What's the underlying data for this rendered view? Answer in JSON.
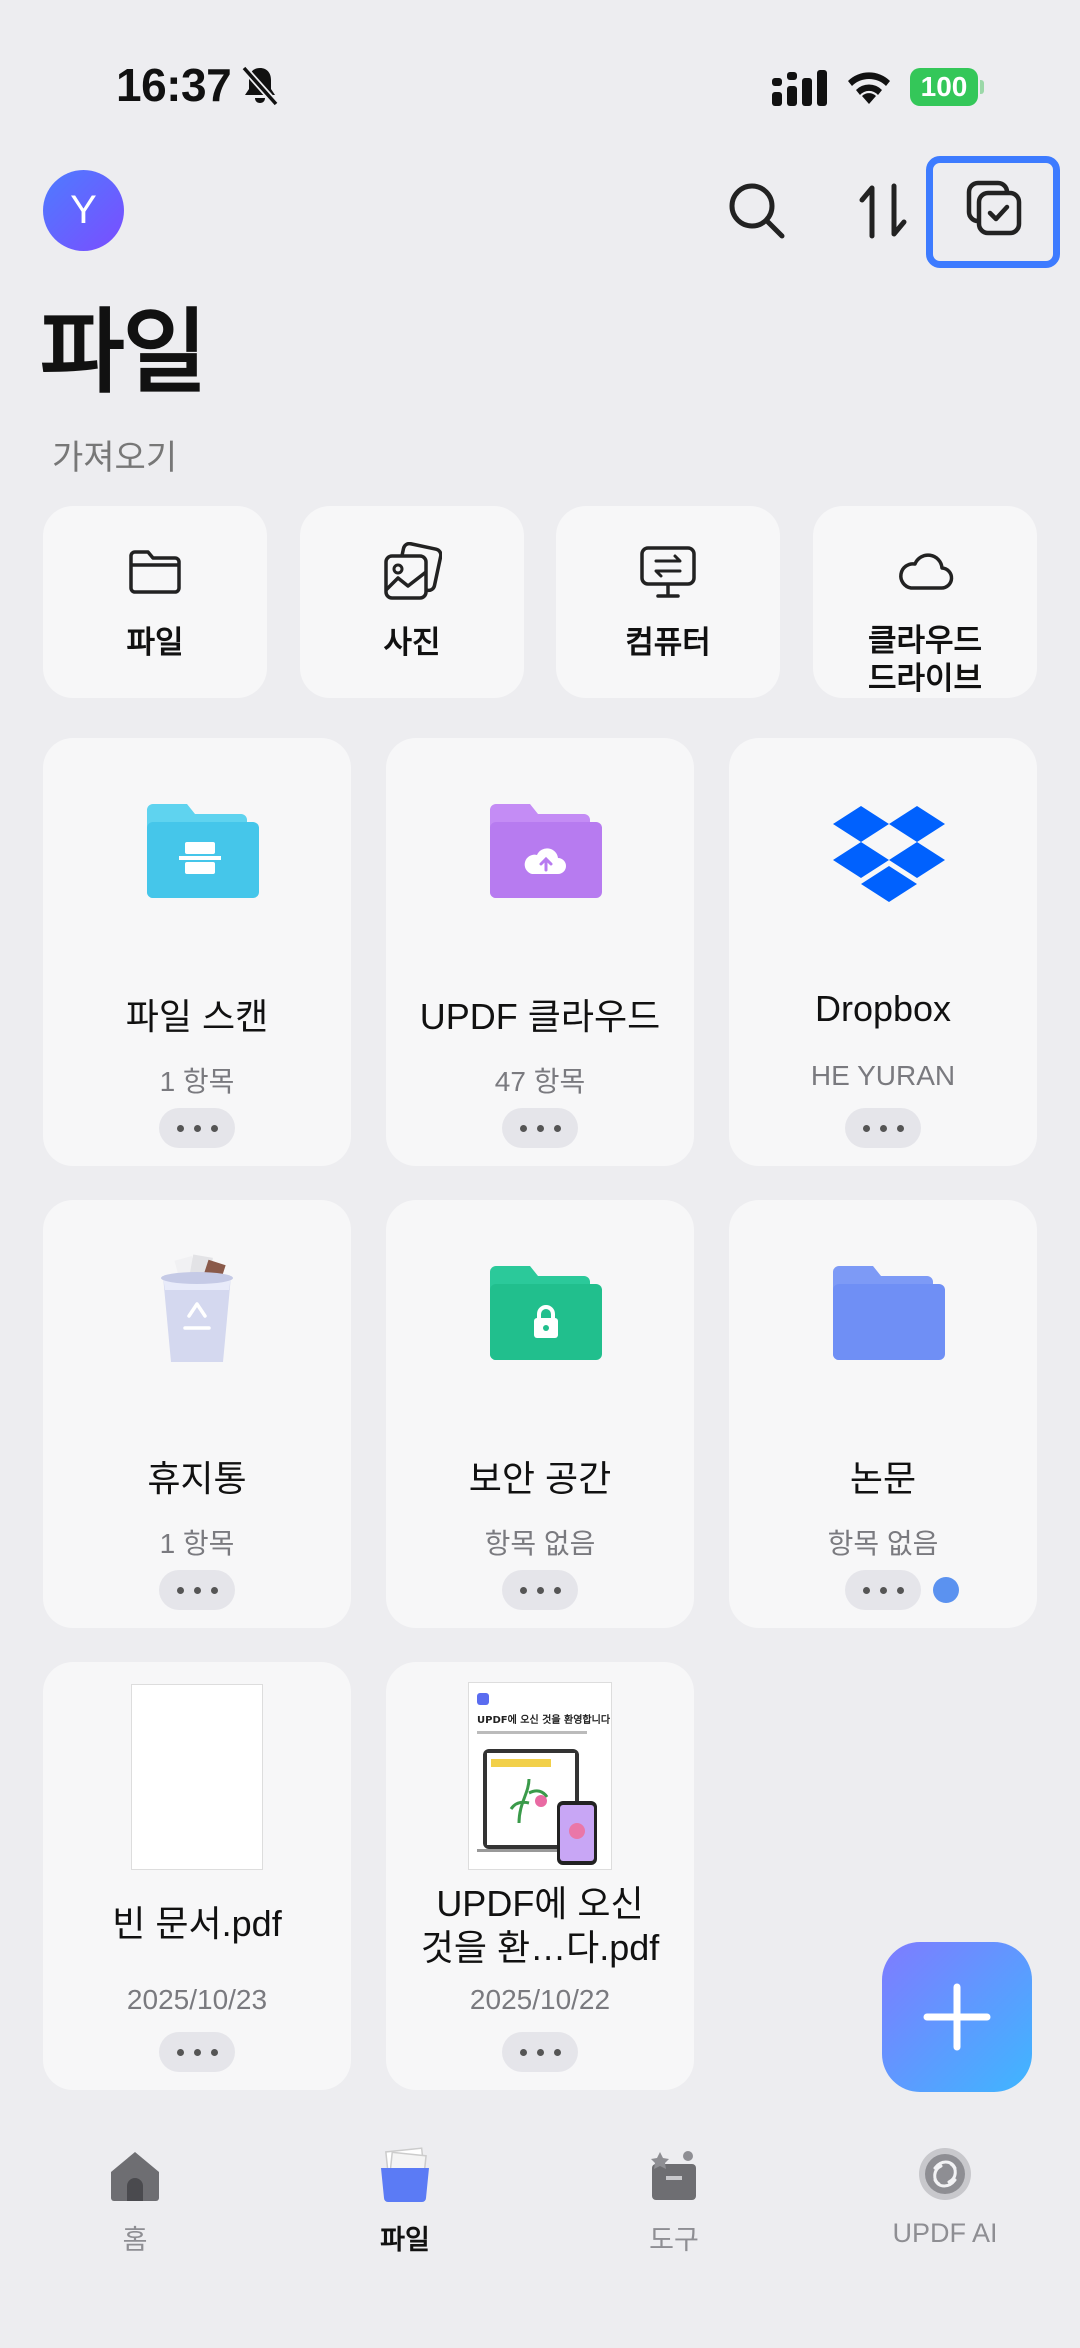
{
  "status_bar": {
    "time": "16:37",
    "battery": "100"
  },
  "header": {
    "avatar_initial": "Y",
    "title": "파일"
  },
  "import": {
    "section_label": "가져오기",
    "items": [
      {
        "label": "파일",
        "icon": "folder-icon"
      },
      {
        "label": "사진",
        "icon": "photos-icon"
      },
      {
        "label": "컴퓨터",
        "icon": "computer-transfer-icon"
      },
      {
        "label": "클라우드\n드라이브",
        "icon": "cloud-icon"
      }
    ]
  },
  "folders": [
    {
      "name": "파일 스캔",
      "sub": "1 항목",
      "icon": "scan-folder-icon",
      "color": "#45c6ea"
    },
    {
      "name": "UPDF 클라우드",
      "sub": "47 항목",
      "icon": "cloud-folder-icon",
      "color": "#b77bf0"
    },
    {
      "name": "Dropbox",
      "sub": "HE YURAN",
      "icon": "dropbox-icon",
      "color": "#0061fe"
    },
    {
      "name": "휴지통",
      "sub": "1 항목",
      "icon": "trash-icon",
      "color": "#c9cde8"
    },
    {
      "name": "보안 공간",
      "sub": "항목 없음",
      "icon": "lock-folder-icon",
      "color": "#21bf8d"
    },
    {
      "name": "논문",
      "sub": "항목 없음",
      "icon": "folder-icon",
      "color": "#6f8ff5"
    }
  ],
  "files": [
    {
      "name": "빈 문서.pdf",
      "date": "2025/10/23"
    },
    {
      "name": "UPDF에 오신\n것을 환…다.pdf",
      "date": "2025/10/22",
      "thumb_title": "UPDF에 오신 것을 환영합니다"
    }
  ],
  "tabs": [
    {
      "label": "홈",
      "icon": "home-icon"
    },
    {
      "label": "파일",
      "icon": "files-icon",
      "active": true
    },
    {
      "label": "도구",
      "icon": "tools-icon"
    },
    {
      "label": "UPDF AI",
      "icon": "ai-icon"
    }
  ],
  "colors": {
    "accent": "#3d7bff",
    "background": "#ededf0",
    "card": "#f7f7f8"
  }
}
